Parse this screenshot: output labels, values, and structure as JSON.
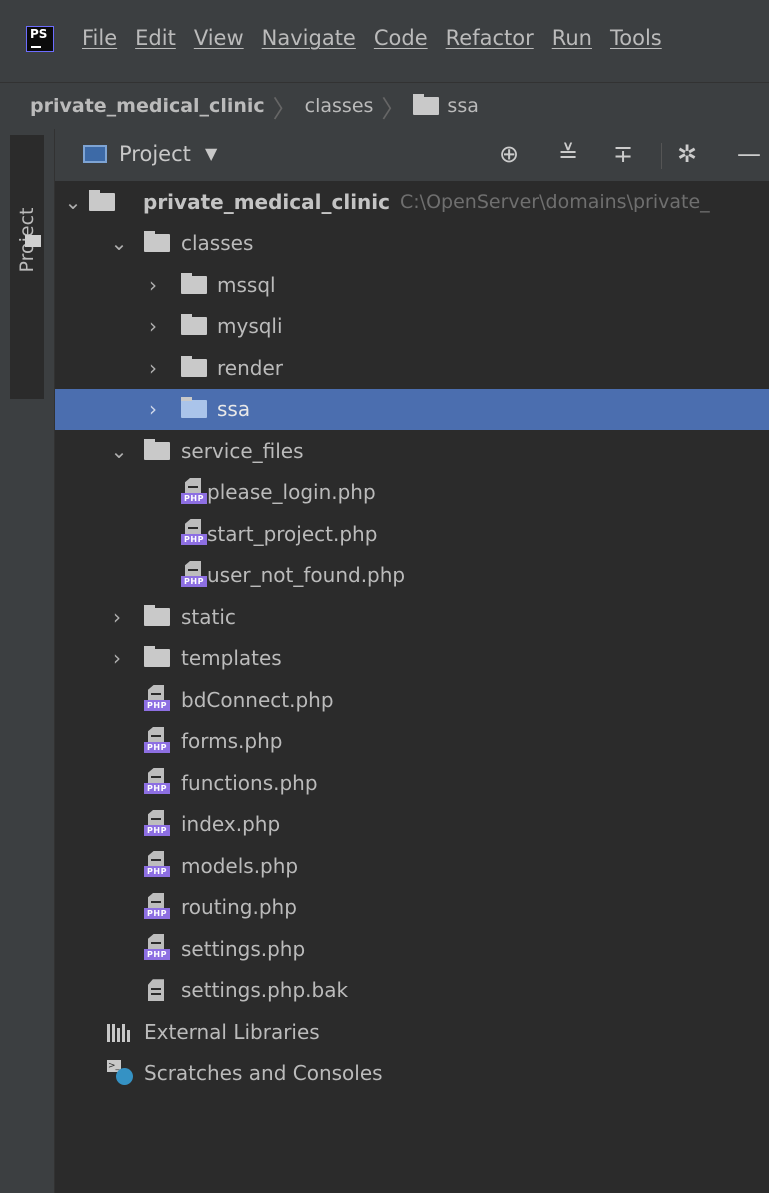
{
  "app": {
    "logo_text": "PS"
  },
  "menu": {
    "items": [
      "File",
      "Edit",
      "View",
      "Navigate",
      "Code",
      "Refactor",
      "Run",
      "Tools"
    ]
  },
  "breadcrumb": {
    "items": [
      "private_medical_clinic",
      "classes",
      "ssa"
    ]
  },
  "toolstrip": {
    "tab_label": "Project"
  },
  "project_panel": {
    "title": "Project",
    "toolbar_icons": [
      "locate-icon",
      "expand-all-icon",
      "collapse-all-icon",
      "gear-icon",
      "hide-icon"
    ]
  },
  "tree": {
    "root": {
      "name": "private_medical_clinic",
      "path": "C:\\OpenServer\\domains\\private_"
    },
    "classes": {
      "name": "classes",
      "children": [
        "mssql",
        "mysqli",
        "render",
        "ssa"
      ]
    },
    "service_files": {
      "name": "service_files",
      "children": [
        "please_login.php",
        "start_project.php",
        "user_not_found.php"
      ]
    },
    "folders": [
      "static",
      "templates"
    ],
    "php_files": [
      "bdConnect.php",
      "forms.php",
      "functions.php",
      "index.php",
      "models.php",
      "routing.php",
      "settings.php"
    ],
    "text_files": [
      "settings.php.bak"
    ],
    "external_libraries": "External Libraries",
    "scratches": "Scratches and Consoles",
    "selected": "ssa",
    "php_tag": "PHP"
  },
  "colors": {
    "background": "#2b2b2b",
    "panel": "#3c3f41",
    "selection": "#4b6eaf",
    "php_badge": "#8d6fe2"
  }
}
